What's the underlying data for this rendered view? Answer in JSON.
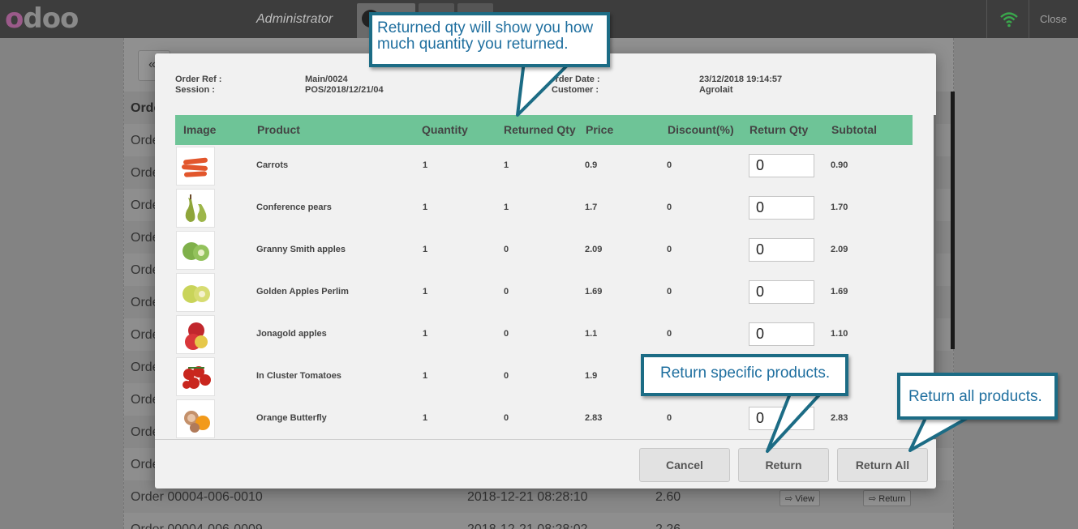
{
  "topbar": {
    "logo": "odoo",
    "user": "Administrator",
    "close_label": "Close",
    "wifi_color": "#3aa74c"
  },
  "background_list": {
    "header_label": "Orde",
    "row_prefix": "Orde",
    "visible_row_1": {
      "order": "Order 00004-006-0010",
      "date": "2018-12-21 08:28:10",
      "amount": "2.60",
      "view": "View",
      "return": "Return"
    },
    "visible_row_2": {
      "order": "Order 00004-006-0009",
      "date": "2018-12-21 08:28:02",
      "amount": "2.26"
    }
  },
  "modal": {
    "order_ref_label": "Order Ref :",
    "order_ref_value": "Main/0024",
    "session_label": "Session :",
    "session_value": "POS/2018/12/21/04",
    "order_date_label": "Order Date :",
    "order_date_value": "23/12/2018 19:14:57",
    "customer_label": "Customer :",
    "customer_value": "Agrolait",
    "columns": [
      "Image",
      "Product",
      "Quantity",
      "Returned Qty",
      "Price",
      "Discount(%)",
      "Return Qty",
      "Subtotal"
    ],
    "rows": [
      {
        "product": "Carrots",
        "quantity": "1",
        "returned": "1",
        "price": "0.9",
        "discount": "0",
        "return_qty": "0",
        "subtotal": "0.90",
        "icon": "carrots-icon"
      },
      {
        "product": "Conference pears",
        "quantity": "1",
        "returned": "1",
        "price": "1.7",
        "discount": "0",
        "return_qty": "0",
        "subtotal": "1.70",
        "icon": "pears-icon"
      },
      {
        "product": "Granny Smith apples",
        "quantity": "1",
        "returned": "0",
        "price": "2.09",
        "discount": "0",
        "return_qty": "0",
        "subtotal": "2.09",
        "icon": "green-apples-icon"
      },
      {
        "product": "Golden Apples Perlim",
        "quantity": "1",
        "returned": "0",
        "price": "1.69",
        "discount": "0",
        "return_qty": "0",
        "subtotal": "1.69",
        "icon": "golden-apples-icon"
      },
      {
        "product": "Jonagold apples",
        "quantity": "1",
        "returned": "0",
        "price": "1.1",
        "discount": "0",
        "return_qty": "0",
        "subtotal": "1.10",
        "icon": "red-apples-icon"
      },
      {
        "product": "In Cluster Tomatoes",
        "quantity": "1",
        "returned": "0",
        "price": "1.9",
        "discount": "",
        "return_qty": "",
        "subtotal": "",
        "icon": "tomatoes-icon"
      },
      {
        "product": "Orange Butterfly",
        "quantity": "1",
        "returned": "0",
        "price": "2.83",
        "discount": "0",
        "return_qty": "0",
        "subtotal": "2.83",
        "icon": "orange-butterfly-icon"
      }
    ],
    "buttons": {
      "cancel": "Cancel",
      "return": "Return",
      "return_all": "Return All"
    },
    "header_color": "#6ec497"
  },
  "callouts": {
    "returned_qty": "Returned qty will show you how much quantity you returned.",
    "return_specific": "Return specific products.",
    "return_all": "Return all products.",
    "border_color": "#1c6c85",
    "text_color": "#1f6f9f"
  }
}
